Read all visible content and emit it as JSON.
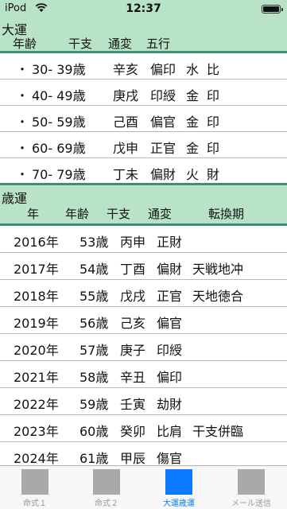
{
  "status": {
    "carrier": "iPod",
    "time": "12:37"
  },
  "daiun": {
    "title": "大運",
    "columns": [
      "年齢",
      "干支",
      "通変",
      "五行"
    ],
    "rows": [
      {
        "bullet": "・",
        "age": "30- 39歳",
        "kanshi": "辛亥",
        "tsuhen": "偏印",
        "gogyo": "水",
        "rel": "比"
      },
      {
        "bullet": "・",
        "age": "40- 49歳",
        "kanshi": "庚戌",
        "tsuhen": "印綬",
        "gogyo": "金",
        "rel": "印"
      },
      {
        "bullet": "・",
        "age": "50- 59歳",
        "kanshi": "己酉",
        "tsuhen": "偏官",
        "gogyo": "金",
        "rel": "印"
      },
      {
        "bullet": "・",
        "age": "60- 69歳",
        "kanshi": "戊申",
        "tsuhen": "正官",
        "gogyo": "金",
        "rel": "印"
      },
      {
        "bullet": "・",
        "age": "70- 79歳",
        "kanshi": "丁未",
        "tsuhen": "偏財",
        "gogyo": "火",
        "rel": "財"
      }
    ]
  },
  "saiun": {
    "title": "歳運",
    "columns": [
      "年",
      "年齢",
      "干支",
      "通変",
      "転換期"
    ],
    "rows": [
      {
        "year": "2016年",
        "age": "53歳",
        "kanshi": "丙申",
        "tsuhen": "正財",
        "tenkan": ""
      },
      {
        "year": "2017年",
        "age": "54歳",
        "kanshi": "丁酉",
        "tsuhen": "偏財",
        "tenkan": "天戦地冲"
      },
      {
        "year": "2018年",
        "age": "55歳",
        "kanshi": "戊戌",
        "tsuhen": "正官",
        "tenkan": "天地徳合"
      },
      {
        "year": "2019年",
        "age": "56歳",
        "kanshi": "己亥",
        "tsuhen": "偏官",
        "tenkan": ""
      },
      {
        "year": "2020年",
        "age": "57歳",
        "kanshi": "庚子",
        "tsuhen": "印綬",
        "tenkan": ""
      },
      {
        "year": "2021年",
        "age": "58歳",
        "kanshi": "辛丑",
        "tsuhen": "偏印",
        "tenkan": ""
      },
      {
        "year": "2022年",
        "age": "59歳",
        "kanshi": "壬寅",
        "tsuhen": "劫財",
        "tenkan": ""
      },
      {
        "year": "2023年",
        "age": "60歳",
        "kanshi": "癸卯",
        "tsuhen": "比肩",
        "tenkan": "干支併臨"
      },
      {
        "year": "2024年",
        "age": "61歳",
        "kanshi": "甲辰",
        "tsuhen": "傷官",
        "tenkan": ""
      }
    ]
  },
  "tabs": [
    {
      "label": "命式１",
      "active": false
    },
    {
      "label": "命式２",
      "active": false
    },
    {
      "label": "大運歳運",
      "active": true
    },
    {
      "label": "メール送信",
      "active": false
    }
  ],
  "colors": {
    "header_bg": "#b9e3c6",
    "rule": "#3f8e79",
    "accent": "#0a7aff",
    "inactive_icon": "#a9a9a9"
  }
}
